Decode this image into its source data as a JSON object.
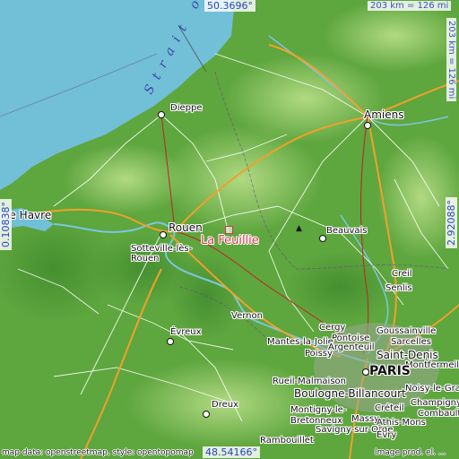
{
  "map": {
    "place": "La Feuillie",
    "coords": {
      "north": "50.3696°",
      "south": "48.54166°",
      "west": "0.10838°",
      "east": "2.92088°"
    },
    "scale": {
      "horizontal": "203 km = 126 mi",
      "vertical": "203 km = 126 mi"
    },
    "credit_left": "map data: openstreetmap, style: opentopomap",
    "credit_right": "image prod. el. ...",
    "sea_label": "Strait of",
    "colors": {
      "sea": "#72bfd8",
      "land": "#5ea63e",
      "highlands": "#9bd06c",
      "motorway": "#f0a12a",
      "road": "#ffffff",
      "place": "#d23b4b",
      "coord": "#2b44c0"
    },
    "cities": [
      {
        "id": "dieppe",
        "label": "Dieppe"
      },
      {
        "id": "amiens",
        "label": "Amiens"
      },
      {
        "id": "le-havre",
        "label": "Le Havre"
      },
      {
        "id": "rouen",
        "label": "Rouen"
      },
      {
        "id": "sotteville",
        "label": "Sotteville-lès-Rouen"
      },
      {
        "id": "beauvais",
        "label": "Beauvais"
      },
      {
        "id": "creil",
        "label": "Creil"
      },
      {
        "id": "senlis",
        "label": "Senlis"
      },
      {
        "id": "vernon",
        "label": "Vernon"
      },
      {
        "id": "evreux",
        "label": "Évreux"
      },
      {
        "id": "cergy",
        "label": "Cergy"
      },
      {
        "id": "pontoise",
        "label": "Pontoise"
      },
      {
        "id": "goussainville",
        "label": "Goussainville"
      },
      {
        "id": "sarcelles",
        "label": "Sarcelles"
      },
      {
        "id": "mantes",
        "label": "Mantes-la-Jolie"
      },
      {
        "id": "poissy",
        "label": "Poissy"
      },
      {
        "id": "argenteuil",
        "label": "Argenteuil"
      },
      {
        "id": "saint-denis",
        "label": "Saint-Denis"
      },
      {
        "id": "montfermeil",
        "label": "Montfermeil"
      },
      {
        "id": "rueil",
        "label": "Rueil-Malmaison"
      },
      {
        "id": "paris",
        "label": "PARIS"
      },
      {
        "id": "noisy",
        "label": "Noisy-le-Grand"
      },
      {
        "id": "boulogne",
        "label": "Boulogne-Billancourt"
      },
      {
        "id": "champigny",
        "label": "Champigny"
      },
      {
        "id": "montigny",
        "label": "Montigny-le-Bretonneux"
      },
      {
        "id": "creteil",
        "label": "Créteil"
      },
      {
        "id": "combault",
        "label": "Combault"
      },
      {
        "id": "massy",
        "label": "Massy"
      },
      {
        "id": "athis",
        "label": "Athis-Mons"
      },
      {
        "id": "savigny",
        "label": "Savigny-sur-Orge"
      },
      {
        "id": "evry",
        "label": "Évry"
      },
      {
        "id": "dreux",
        "label": "Dreux"
      },
      {
        "id": "rambouillet",
        "label": "Rambouillet"
      }
    ]
  }
}
